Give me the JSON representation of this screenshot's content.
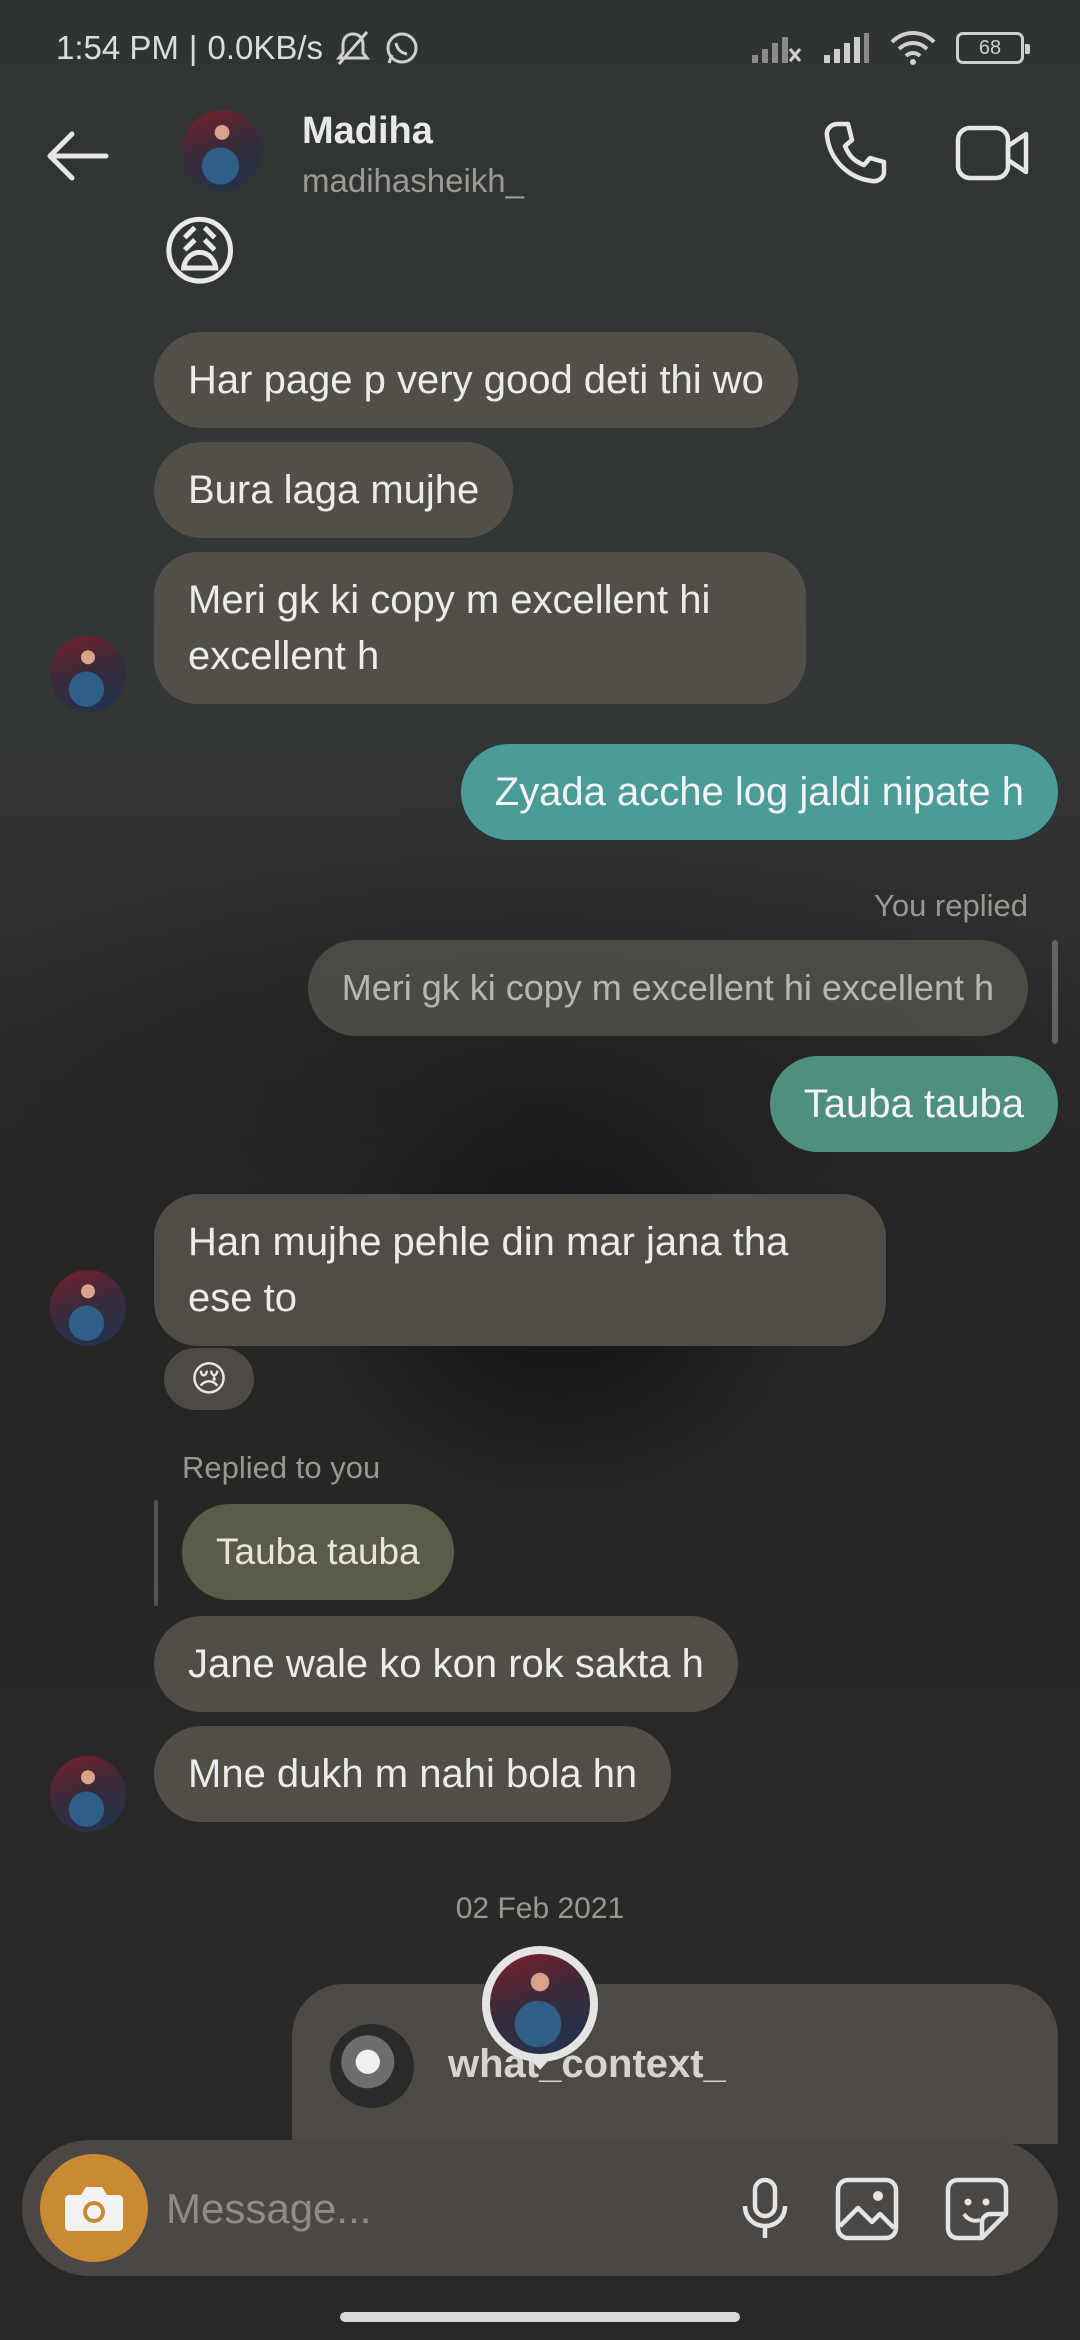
{
  "status_bar": {
    "time": "1:54 PM",
    "separator": "|",
    "speed": "0.0KB/s",
    "battery": "68"
  },
  "header": {
    "name": "Madiha",
    "username": "madihasheikh_"
  },
  "messages": {
    "emoji_top": "😩",
    "m1": "Har page p very good deti thi wo",
    "m2": "Bura laga mujhe",
    "m3": "Meri gk ki copy m excellent hi excellent h",
    "m4": "Zyada acche log jaldi nipate h",
    "you_replied_label": "You replied",
    "quoted_text": "Meri gk ki copy m excellent hi excellent h",
    "m5": "Tauba tauba",
    "m6": "Han mujhe pehle din mar jana tha ese to",
    "reaction": "😢",
    "replied_to_you_label": "Replied to you",
    "reply_ref_text": "Tauba tauba",
    "m7": "Jane wale ko kon rok sakta h",
    "m8": "Mne dukh m nahi bola hn",
    "date_separator": "02 Feb 2021",
    "shared_post_user": "what_context_"
  },
  "composer": {
    "placeholder": "Message..."
  }
}
